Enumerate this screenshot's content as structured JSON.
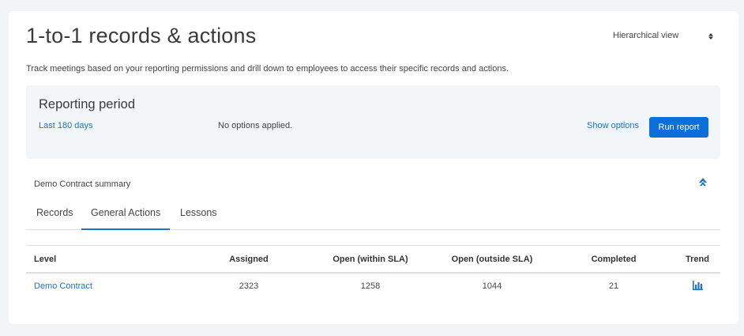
{
  "page": {
    "title": "1-to-1 records & actions",
    "view_select": "Hierarchical view",
    "description": "Track meetings based on your reporting permissions and drill down to employees to access their specific records and actions."
  },
  "reporting_period": {
    "title": "Reporting period",
    "range_link": "Last 180 days",
    "options_status": "No options applied.",
    "show_options": "Show options",
    "run_report": "Run report"
  },
  "summary": {
    "label": "Demo Contract summary",
    "collapse_icon": "chevron-up-icon"
  },
  "tabs": [
    {
      "label": "Records",
      "active": false
    },
    {
      "label": "General Actions",
      "active": true
    },
    {
      "label": "Lessons",
      "active": false
    }
  ],
  "table": {
    "headers": {
      "level": "Level",
      "assigned": "Assigned",
      "open_within": "Open (within SLA)",
      "open_outside": "Open (outside SLA)",
      "completed": "Completed",
      "trend": "Trend"
    },
    "rows": [
      {
        "level": "Demo Contract",
        "assigned": "2323",
        "open_within": "1258",
        "open_outside": "1044",
        "completed": "21",
        "trend_icon": "bar-chart-icon"
      }
    ]
  },
  "colors": {
    "accent": "#0a6fdc",
    "link": "#1f72c4",
    "panel_bg": "#f3f6f9",
    "page_bg": "#f3f4f6"
  }
}
